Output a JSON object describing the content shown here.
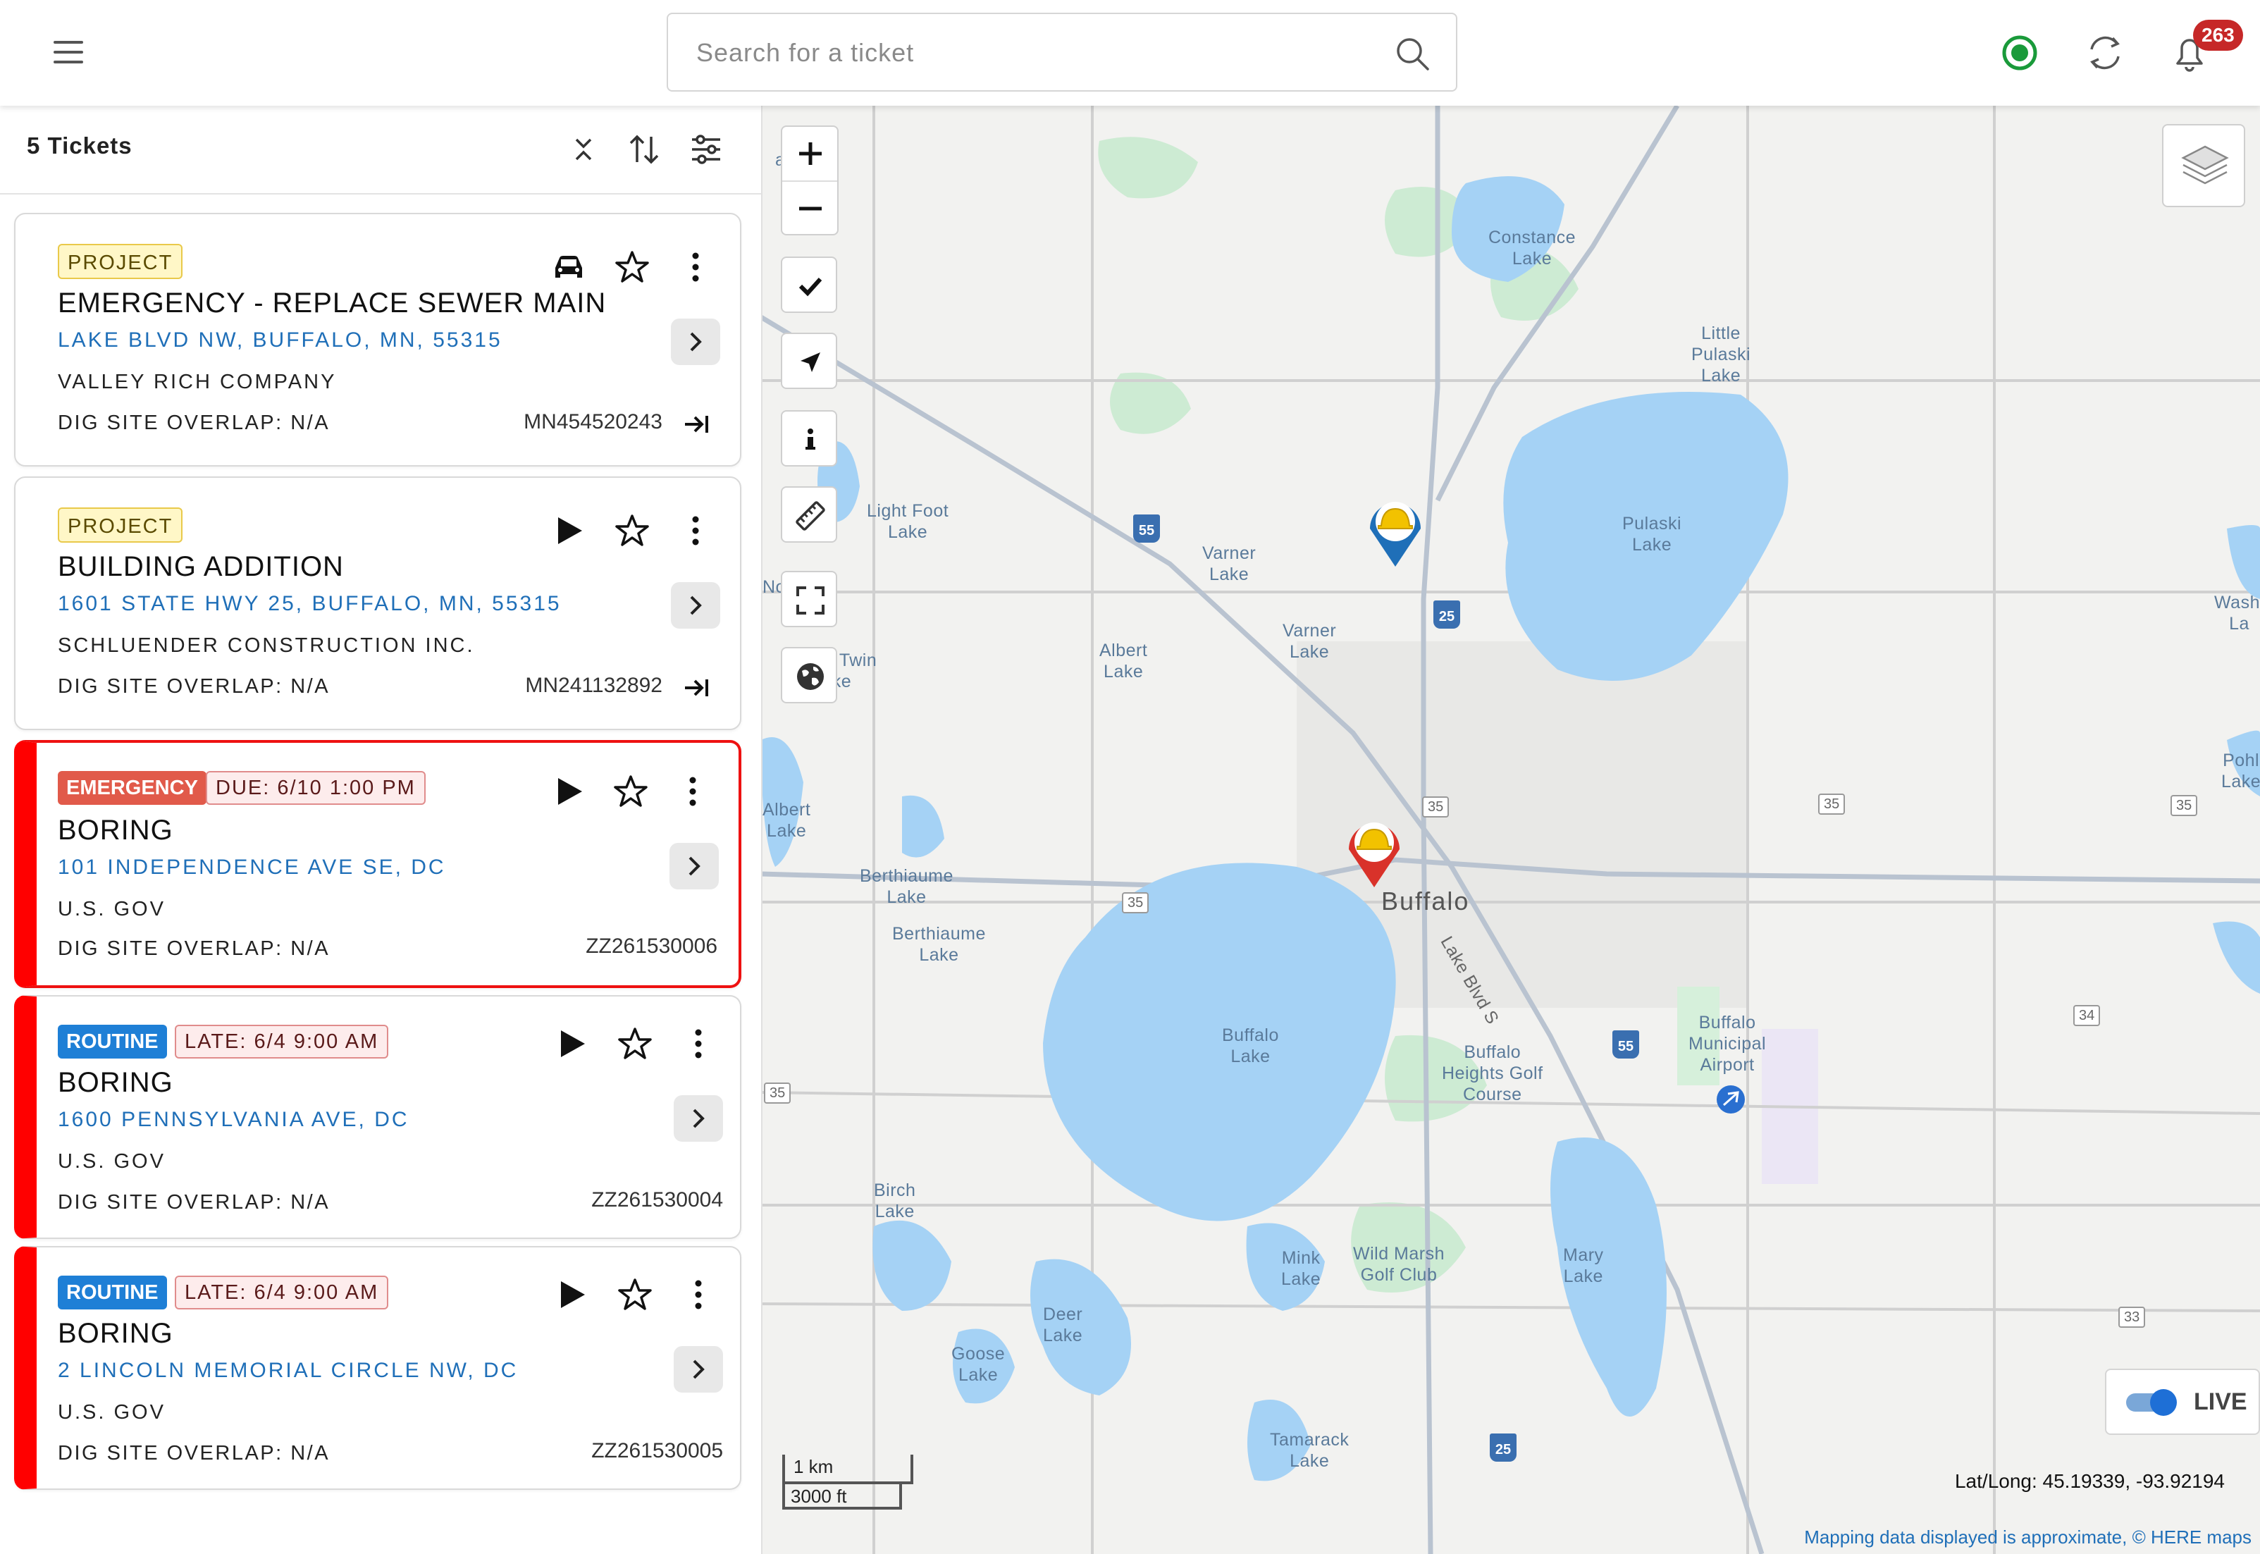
{
  "header": {
    "search_placeholder": "Search for a ticket",
    "notification_count": "263",
    "status_color": "#1a9a3a"
  },
  "panel": {
    "ticket_count": "5 Tickets"
  },
  "tickets": [
    {
      "tags": [
        "PROJECT"
      ],
      "title": "EMERGENCY - REPLACE SEWER MAIN",
      "address": "LAKE BLVD NW, BUFFALO, MN, 55315",
      "company": "VALLEY RICH COMPANY",
      "overlap": "DIG SITE OVERLAP: N/A",
      "id": "MN454520243",
      "action_icon": "car-icon"
    },
    {
      "tags": [
        "PROJECT"
      ],
      "title": "BUILDING ADDITION",
      "address": "1601 STATE HWY 25, BUFFALO, MN, 55315",
      "company": "SCHLUENDER CONSTRUCTION INC.",
      "overlap": "DIG SITE OVERLAP: N/A",
      "id": "MN241132892",
      "action_icon": "play-icon"
    },
    {
      "tags": [
        "EMERGENCY",
        "DUE: 6/10 1:00 PM"
      ],
      "title": "BORING",
      "address": "101 INDEPENDENCE AVE SE, DC",
      "company": "U.S. GOV",
      "overlap": "DIG SITE OVERLAP: N/A",
      "id": "ZZ261530006",
      "action_icon": "play-icon"
    },
    {
      "tags": [
        "ROUTINE",
        "LATE: 6/4 9:00 AM"
      ],
      "title": "BORING",
      "address": "1600 PENNSYLVANIA AVE, DC",
      "company": "U.S. GOV",
      "overlap": "DIG SITE OVERLAP: N/A",
      "id": "ZZ261530004",
      "action_icon": "play-icon"
    },
    {
      "tags": [
        "ROUTINE",
        "LATE: 6/4 9:00 AM"
      ],
      "title": "BORING",
      "address": "2 LINCOLN MEMORIAL CIRCLE NW, DC",
      "company": "U.S. GOV",
      "overlap": "DIG SITE OVERLAP: N/A",
      "id": "ZZ261530005",
      "action_icon": "play-icon"
    }
  ],
  "map": {
    "controls": [
      "zoom-in",
      "zoom-out",
      "check",
      "locate",
      "info",
      "measure",
      "fullscreen",
      "globe"
    ],
    "labels": {
      "constance": "Constance\nLake",
      "little_pulaski": "Little\nPulaski\nLake",
      "pulaski": "Pulaski\nLake",
      "light_foot": "Light Foot\nLake",
      "varner1": "Varner\nLake",
      "varner2": "Varner\nLake",
      "albert": "Albert\nLake",
      "albert_left": "Albert\nLake",
      "south_twin": "South Twin\nLake",
      "berthiaume1": "Berthiaume\nLake",
      "berthiaume2": "Berthiaume\nLake",
      "buffalo_lake": "Buffalo\nLake",
      "buffalo_town": "Buffalo",
      "golf": "Buffalo\nHeights Golf\nCourse",
      "airport": "Buffalo\nMunicipal\nAirport",
      "birch": "Birch\nLake",
      "mink": "Mink\nLake",
      "wild_marsh": "Wild Marsh\nGolf Club",
      "mary": "Mary\nLake",
      "deer": "Deer\nLake",
      "goose": "Goose\nLake",
      "tamarack": "Tamarack\nLake",
      "pohl": "Pohl\nLake",
      "washi": "Washi\nLa",
      "lake_blvd": "Lake Blvd S",
      "an": "an",
      "no_in": "No      in"
    },
    "highways": {
      "h35a": "35",
      "h35b": "35",
      "h35c": "35",
      "h35d": "35",
      "h35e": "35",
      "h34": "34",
      "h33": "33",
      "us55a": "55",
      "us55b": "55",
      "us25a": "25",
      "us25b": "25"
    },
    "live_label": "LIVE",
    "live_on": true,
    "scale_km": "1 km",
    "scale_ft": "3000 ft",
    "latlong": "Lat/Long: 45.19339, -93.92194",
    "attribution_text": "Mapping data displayed is approximate, © ",
    "attribution_link": "HERE maps",
    "water_color": "#a5d2f5",
    "park_color": "#cdebd3"
  }
}
